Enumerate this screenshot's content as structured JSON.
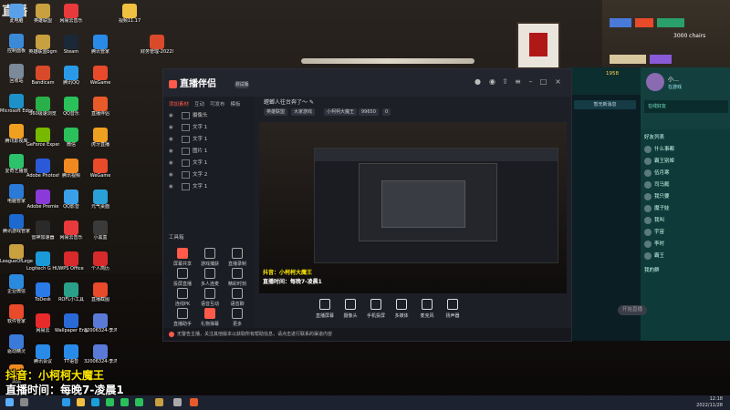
{
  "watermark": "直播",
  "desktop_icons_left": [
    {
      "label": "此电脑",
      "color": "#5aa0e8"
    },
    {
      "label": "控制面板",
      "color": "#3a8ad8"
    },
    {
      "label": "回收站",
      "color": "#7a8a99"
    },
    {
      "label": "Microsoft Edge",
      "color": "#1e90c8"
    },
    {
      "label": "腾讯影视库",
      "color": "#f0a020"
    },
    {
      "label": "爱奇艺播放",
      "color": "#2cc26b"
    },
    {
      "label": "电脑管家",
      "color": "#2a7ad8"
    },
    {
      "label": "腾讯游戏管家",
      "color": "#1c6ad0"
    },
    {
      "label": "LeagueOfLegends",
      "color": "#c8a040"
    },
    {
      "label": "企业微信",
      "color": "#2a8ae0"
    },
    {
      "label": "软件管家",
      "color": "#e84a2a"
    },
    {
      "label": "驱动精灵",
      "color": "#3a7ad8"
    },
    {
      "label": "滴滴",
      "color": "#f08a20"
    }
  ],
  "desktop_icons_col2": [
    {
      "label": "英雄联盟",
      "color": "#c8a040"
    },
    {
      "label": "英雄联盟bgm",
      "color": "#c8a040"
    },
    {
      "label": "Bandicam",
      "color": "#d84a2a"
    },
    {
      "label": "360极速浏览",
      "color": "#2ab04a"
    },
    {
      "label": "GeForce Experience",
      "color": "#76b900"
    },
    {
      "label": "Adobe Photosh",
      "color": "#2a5ad8"
    },
    {
      "label": "Adobe Premie",
      "color": "#8a3ad8"
    },
    {
      "label": "雷神加速器",
      "color": "#2a2a2a"
    },
    {
      "label": "Logitech G HUB",
      "color": "#1a9ad8"
    },
    {
      "label": "ToDesk",
      "color": "#2a7ae8"
    },
    {
      "label": "网易云",
      "color": "#e82a2a"
    },
    {
      "label": "腾讯会议",
      "color": "#2a8ae8"
    }
  ],
  "desktop_icons_col3": [
    {
      "label": "网易云音乐",
      "color": "#e83a3a"
    },
    {
      "label": "Steam",
      "color": "#1b2838"
    },
    {
      "label": "腾讯QQ",
      "color": "#2a9ae8"
    },
    {
      "label": "QQ音乐",
      "color": "#2ac05a"
    },
    {
      "label": "微信",
      "color": "#2ac05a"
    },
    {
      "label": "腾讯视频",
      "color": "#f08a20"
    },
    {
      "label": "QQ影音",
      "color": "#3aa0e8"
    },
    {
      "label": "网易云音乐",
      "color": "#e83a3a"
    },
    {
      "label": "WPS Office",
      "color": "#d82a2a"
    },
    {
      "label": "ROFL小工具",
      "color": "#2aa08a"
    },
    {
      "label": "Wallpaper Engine",
      "color": "#2a6ad8"
    },
    {
      "label": "TT语音",
      "color": "#2a8ae8"
    }
  ],
  "desktop_icons_col4": [
    {
      "label": "腾讯管家",
      "color": "#2a8ae8"
    },
    {
      "label": "WeGame",
      "color": "#e84a2a"
    },
    {
      "label": "直播伴侣",
      "color": "#e85a2a"
    },
    {
      "label": "虎牙直播",
      "color": "#f0a020"
    },
    {
      "label": "WeGame",
      "color": "#e84a2a"
    },
    {
      "label": "元气桌面",
      "color": "#2aa0d8"
    },
    {
      "label": "小黑盒",
      "color": "#3a3a3a"
    },
    {
      "label": "个人简历",
      "color": "#d82a2a"
    },
    {
      "label": "直播截图",
      "color": "#e84a2a"
    },
    {
      "label": "32006324-李鸿..",
      "color": "#5a7ad8"
    },
    {
      "label": "32006324-李鸿..",
      "color": "#5a7ad8"
    }
  ],
  "desktop_icons_top": [
    {
      "label": "视频11.17",
      "color": "#f0c040"
    },
    {
      "label": "财务管理-2022年8..",
      "color": "#d84a2a"
    }
  ],
  "app": {
    "brand": "直播伴侣",
    "beta": "测试版",
    "tabs": [
      "添加素材",
      "互动",
      "可发布",
      "模板"
    ],
    "layers": [
      "摄像头",
      "文字 1",
      "文字 1",
      "图片 1",
      "文字 1",
      "文字 2",
      "文字 1"
    ],
    "workspace_label": "工具箱",
    "tools": [
      "屏幕共享",
      "游戏捕获",
      "直播录制",
      "投屏直播",
      "多人连麦",
      "精彩时刻",
      "连线PK",
      "语音互动",
      "语音聊",
      "直播助手",
      "礼物弹幕",
      "更多"
    ],
    "stream_title": "螳螂人往台奔了～",
    "edit_icon": "✎",
    "tag_game": "英雄联盟",
    "tag_partition": "大家游戏",
    "tag_host": "小柯柯大魔王",
    "tag_id": "99650",
    "tag_count": "0",
    "bottom_actions": [
      "直播屏幕",
      "摄像头",
      "手机投屏",
      "多媒体",
      "麦克风",
      "扬声器"
    ],
    "start_button": "开始直播",
    "status_text": "无警告主播，关注其他版本以获取所有帮助信息，请点击进行联系的渠道内容"
  },
  "right_panel": {
    "username": "小…",
    "level": "1958",
    "status": "在游戏",
    "friends_header": "好友列表",
    "group_label": "在线好友",
    "friends": [
      "什么事都",
      "霸王别姬",
      "伍月寒",
      "司马懿",
      "我只要",
      "魔子娃",
      "我叫",
      "宇宙",
      "李时",
      "霸王"
    ],
    "notice": "暂无新消息",
    "group2_label": "我的群"
  },
  "overlay": {
    "line1": "抖音：小柯柯大魔王",
    "line2": "直播时间：每晚7-凌晨1"
  },
  "taskbar": {
    "time": "12:18",
    "date": "2022/11/28"
  },
  "shelf_text": "3000 chairs"
}
